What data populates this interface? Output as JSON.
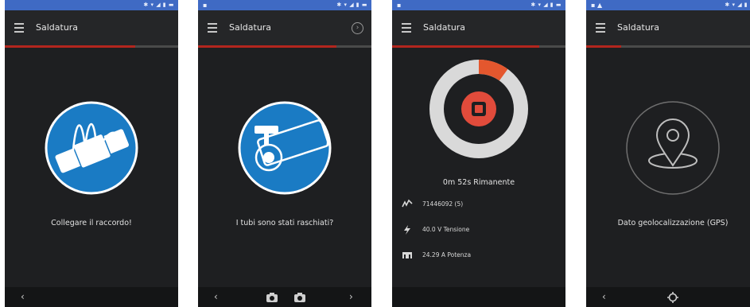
{
  "screens": [
    {
      "title": "Saldatura",
      "caption": "Collegare il raccordo!",
      "icon": "fitting-connection-icon",
      "progress": 0.75,
      "nav": [
        "back-chevron"
      ]
    },
    {
      "title": "Saldatura",
      "caption": "I tubi sono stati raschiati?",
      "icon": "pipe-scraping-icon",
      "progress": 0.8,
      "nav": [
        "back-chevron",
        "camera",
        "camera",
        "forward-chevron"
      ]
    },
    {
      "title": "Saldatura",
      "remaining": "0m 52s Rimanente",
      "progress": 0.85,
      "ring_progress": 0.1,
      "details": [
        {
          "icon": "barcode-icon",
          "text": "71446092 (5)"
        },
        {
          "icon": "bolt-icon",
          "text": "40.0 V Tensione"
        },
        {
          "icon": "power-icon",
          "text": "24.29 A Potenza"
        }
      ]
    },
    {
      "title": "Saldatura",
      "caption": "Dato geolocalizzazione (GPS)",
      "icon": "location-pin-icon",
      "progress": 0.2,
      "nav": [
        "back-chevron",
        "gps-target"
      ]
    }
  ],
  "colors": {
    "status_bar": "#3f6ac4",
    "accent_red": "#b3261e",
    "icon_blue": "#1a7bc4",
    "ring_orange": "#e4572e",
    "background": "#1e1f21"
  }
}
